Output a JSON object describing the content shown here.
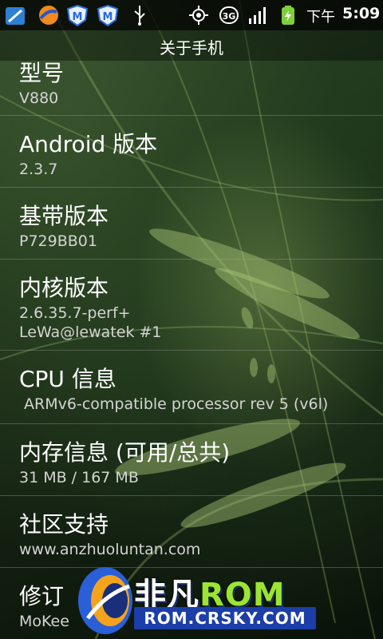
{
  "status_bar": {
    "icons": [
      "app-store-icon",
      "browser-icon",
      "security-m-icon",
      "security-m-icon",
      "usb-icon",
      "gps-icon",
      "3g-icon",
      "signal-icon",
      "battery-charging-icon"
    ],
    "ampm": "下午",
    "time": "5:09"
  },
  "title": "关于手机",
  "items": [
    {
      "title": "型号",
      "value": "V880"
    },
    {
      "title": "Android 版本",
      "value": "2.3.7"
    },
    {
      "title": "基带版本",
      "value": "P729BB01"
    },
    {
      "title": "内核版本",
      "value": "2.6.35.7-perf+",
      "value2": "LeWa@lewatek #1"
    },
    {
      "title": "CPU 信息",
      "value": " ARMv6-compatible processor rev 5 (v6l)"
    },
    {
      "title": "内存信息 (可用/总共)",
      "value": "31 MB / 167 MB"
    },
    {
      "title": "社区支持",
      "value": "www.anzhuoluntan.com"
    },
    {
      "title": "修订",
      "value": "MoKee"
    }
  ],
  "watermark": {
    "brand_cn": "非凡",
    "brand_rom": "ROM",
    "url": "ROM.CRSKY.COM"
  },
  "colors": {
    "status_bar_bg": "#000000",
    "text_primary": "#ffffff",
    "text_secondary": "#d4d4d4",
    "divider": "#aaaaaa",
    "watermark_rom": "#9be532",
    "watermark_url_bg": "#1b3ea8"
  }
}
